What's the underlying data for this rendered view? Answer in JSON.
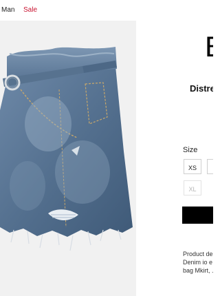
{
  "nav": {
    "man": "Man",
    "sale": "Sale"
  },
  "product": {
    "brand": "B",
    "title": "Distre",
    "size_label": "Size",
    "sizes": [
      "XS",
      "",
      "XL"
    ],
    "add_button": "",
    "description": [
      "Product de",
      "Denim io e",
      "bag Mkirt, ."
    ]
  },
  "colors": {
    "sale": "#c8102e",
    "denim": "#5a7796",
    "button": "#000000"
  }
}
